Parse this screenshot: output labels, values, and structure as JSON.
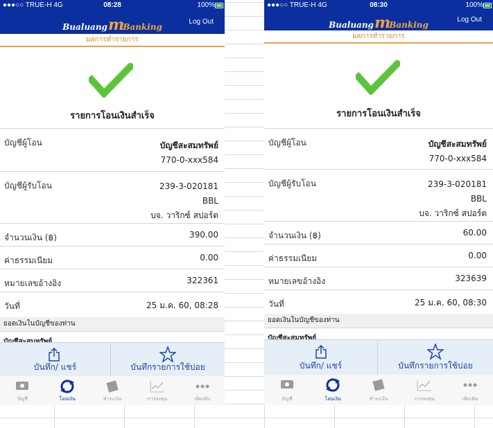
{
  "screens": [
    {
      "status": {
        "carrier": "●●●○○ TRUE-H  4G",
        "time": "08:28",
        "battery": "100%"
      },
      "brand": {
        "prefix": "Bualuang",
        "mark": "m",
        "suffix": "Banking"
      },
      "logout_label": "Log Out",
      "subtitle": "ผลการทำรายการ",
      "success_title": "รายการโอนเงินสำเร็จ",
      "from": {
        "label": "บัญชีผู้โอน",
        "name": "บัญชีสะสมทรัพย์",
        "number": "770-0-xxx584"
      },
      "to": {
        "label": "บัญชีผู้รับโอน",
        "number": "239-3-020181",
        "bank": "BBL",
        "name": "บจ. วาริกซ์ สปอร์ต"
      },
      "amount": {
        "label": "จำนวนเงิน (฿)",
        "value": "390.00"
      },
      "fee": {
        "label": "ค่าธรรมเนียม",
        "value": "0.00"
      },
      "reference": {
        "label": "หมายเลขอ้างอิง",
        "value": "322361"
      },
      "date": {
        "label": "วันที่",
        "value": "25 ม.ค. 60, 08:28"
      },
      "balance_header": "ยอดเงินในบัญชีของท่าน",
      "balance_peek": "บัญชีสะสมทรัพย์",
      "actions": {
        "save_share": "บันทึก/ แชร์",
        "save_favorite": "บันทึกรายการใช้บ่อย"
      },
      "tabs": [
        "บัญชี",
        "โอนเงิน",
        "ชำระเงิน",
        "การลงทุน",
        "เพิ่มเติม"
      ]
    },
    {
      "status": {
        "carrier": "●●●○○ TRUE-H  4G",
        "time": "08:30",
        "battery": "100%"
      },
      "brand": {
        "prefix": "Bualuang",
        "mark": "m",
        "suffix": "Banking"
      },
      "logout_label": "Log Out",
      "subtitle": "ผลการทำรายการ",
      "success_title": "รายการโอนเงินสำเร็จ",
      "from": {
        "label": "บัญชีผู้โอน",
        "name": "บัญชีสะสมทรัพย์",
        "number": "770-0-xxx584"
      },
      "to": {
        "label": "บัญชีผู้รับโอน",
        "number": "239-3-020181",
        "bank": "BBL",
        "name": "บจ. วาริกซ์ สปอร์ต"
      },
      "amount": {
        "label": "จำนวนเงิน (฿)",
        "value": "60.00"
      },
      "fee": {
        "label": "ค่าธรรมเนียม",
        "value": "0.00"
      },
      "reference": {
        "label": "หมายเลขอ้างอิง",
        "value": "323639"
      },
      "date": {
        "label": "วันที่",
        "value": "25 ม.ค. 60, 08:30"
      },
      "balance_header": "ยอดเงินในบัญชีของท่าน",
      "balance_peek": "บัญชีสะสมทรัพย์",
      "actions": {
        "save_share": "บันทึก/ แชร์",
        "save_favorite": "บันทึกรายการใช้บ่อย"
      },
      "tabs": [
        "บัญชี",
        "โอนเงิน",
        "ชำระเงิน",
        "การลงทุน",
        "เพิ่มเติม"
      ]
    }
  ],
  "colors": {
    "header": "#0b2f9e",
    "accent": "#f2a53b",
    "check": "#5cc43a",
    "active_tab": "#0b2f9e"
  }
}
